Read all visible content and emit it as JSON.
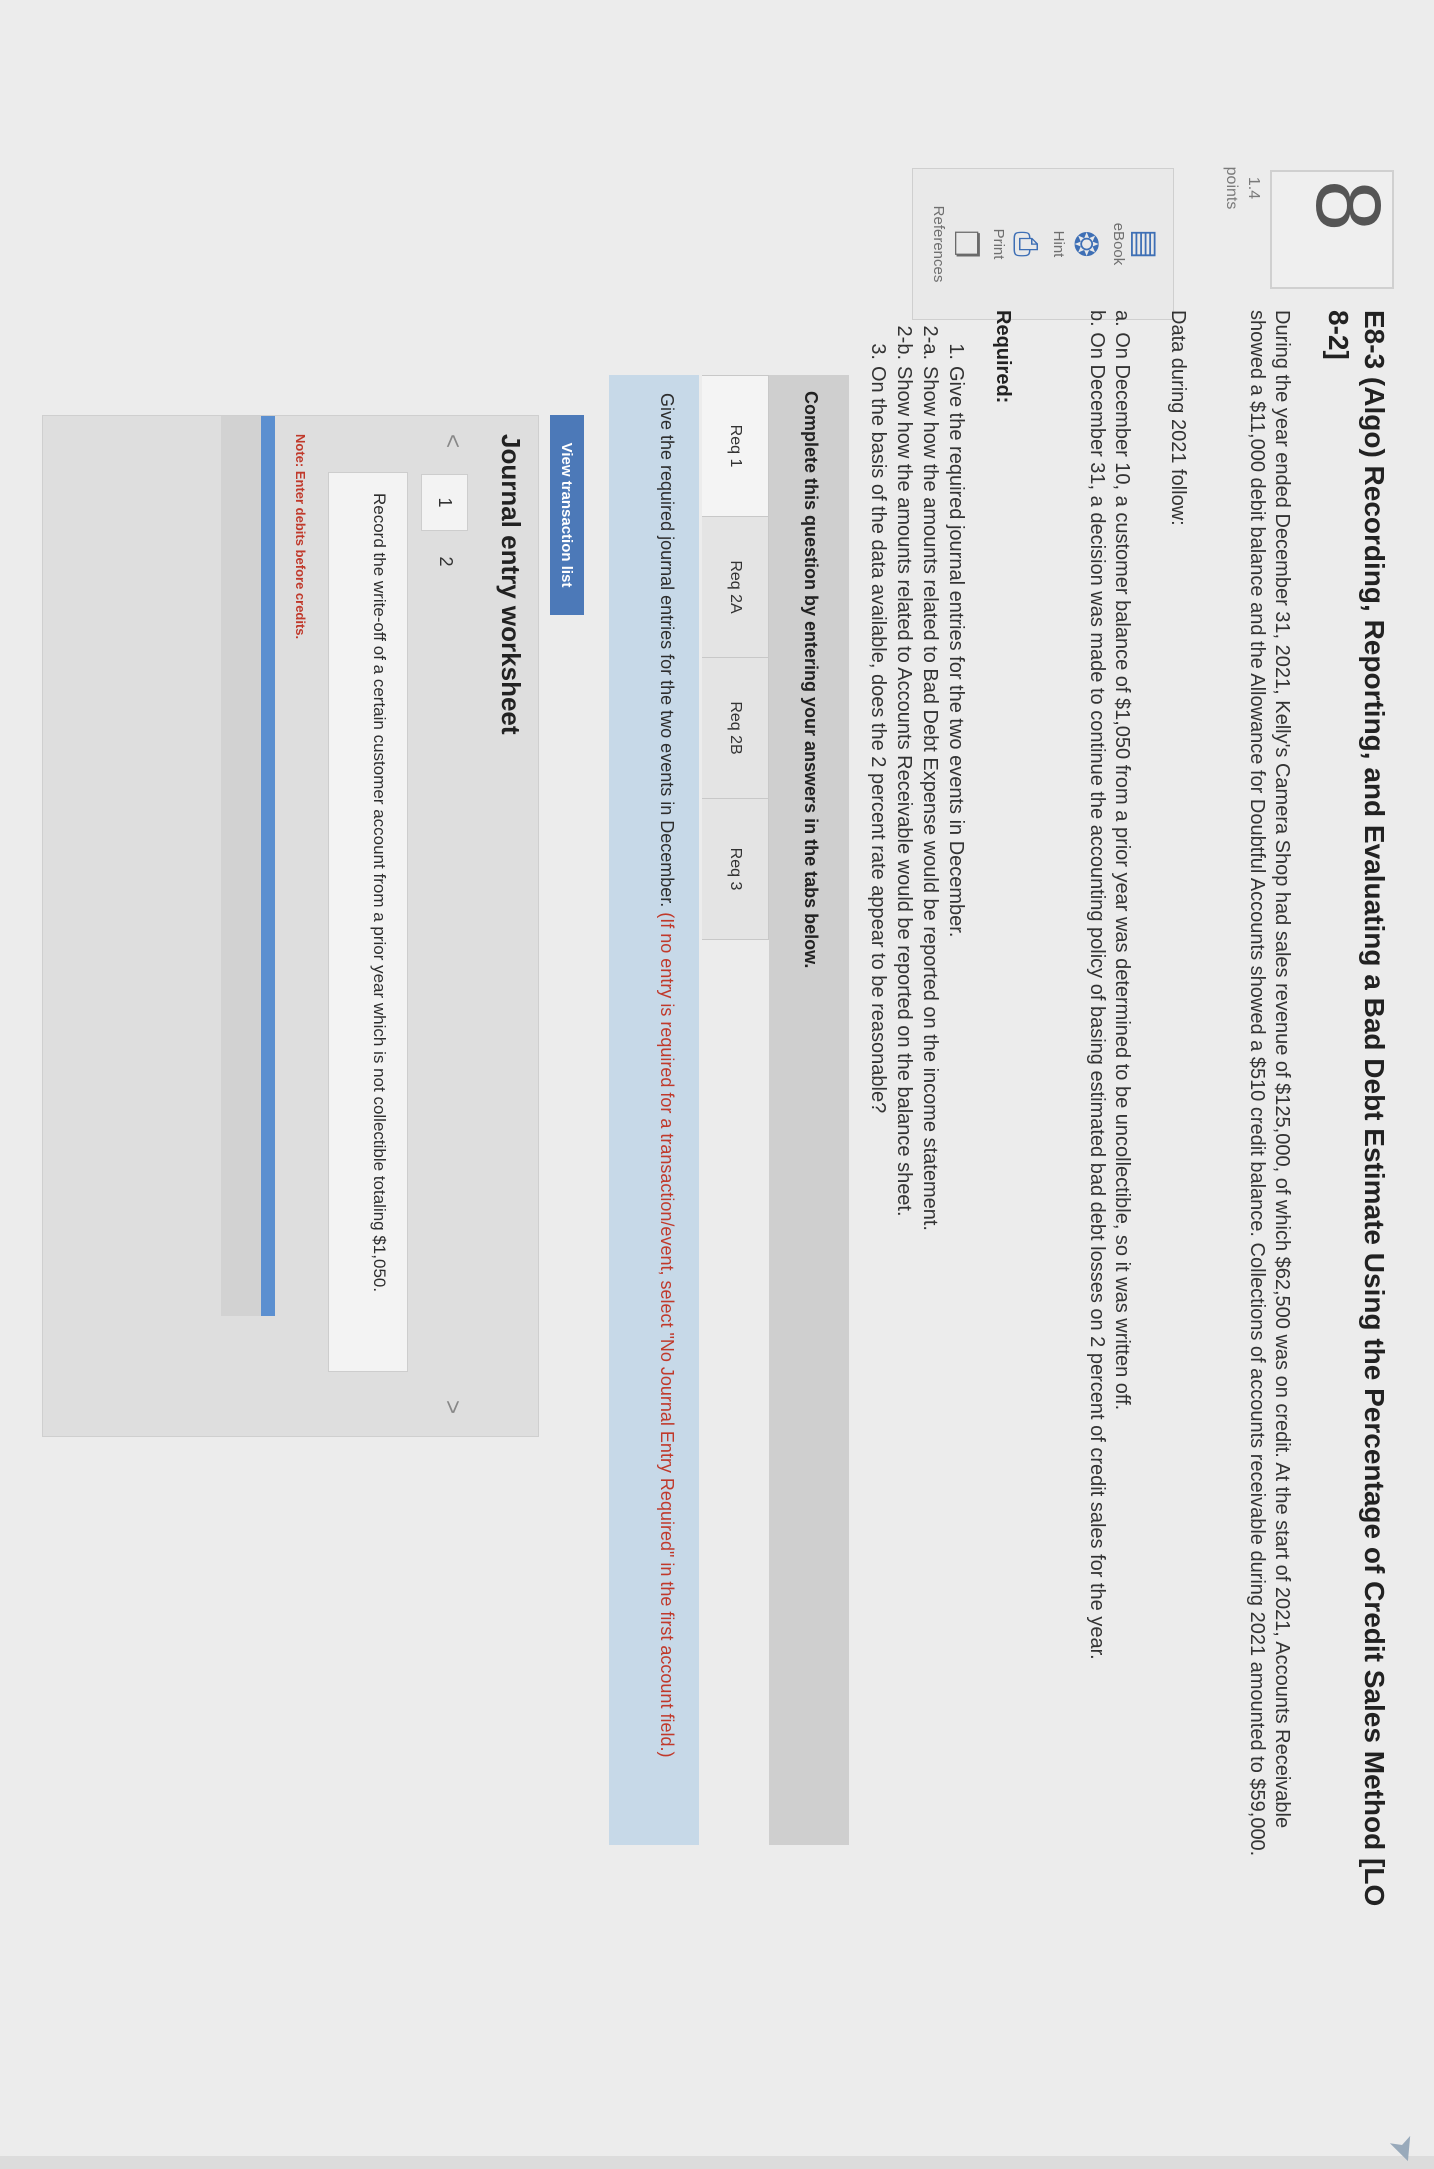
{
  "question": {
    "number": "8",
    "points_value": "1.4",
    "points_label": "points",
    "title": "E8-3 (Algo) Recording, Reporting, and Evaluating a Bad Debt Estimate Using the Percentage of Credit Sales Method [LO 8-2]",
    "intro": "During the year ended December 31, 2021, Kelly's Camera Shop had sales revenue of $125,000, of which $62,500 was on credit. At the start of 2021, Accounts Receivable showed a $11,000 debit balance and the Allowance for Doubtful Accounts showed a $510 credit balance. Collections of accounts receivable during 2021 amounted to $59,000.",
    "data_label": "Data during 2021 follow:",
    "events": [
      "a. On December 10, a customer balance of $1,050 from a prior year was determined to be uncollectible, so it was written off.",
      "b. On December 31, a decision was made to continue the accounting policy of basing estimated bad debt losses on 2 percent of credit sales for the year."
    ],
    "required_heading": "Required:",
    "required": [
      {
        "num": "1.",
        "text": "Give the required journal entries for the two events in December."
      },
      {
        "num": "2-a.",
        "text": "Show how the amounts related to Bad Debt Expense would be reported on the income statement."
      },
      {
        "num": "2-b.",
        "text": "Show how the amounts related to Accounts Receivable would be reported on the balance sheet."
      },
      {
        "num": "3.",
        "text": "On the basis of the data available, does the 2 percent rate appear to be reasonable?"
      }
    ]
  },
  "tools": [
    {
      "label": "eBook",
      "icon": "book-icon"
    },
    {
      "label": "Hint",
      "icon": "lifebuoy-icon"
    },
    {
      "label": "Print",
      "icon": "printer-icon"
    },
    {
      "label": "References",
      "icon": "copy-pages-icon"
    }
  ],
  "complete_instruction": "Complete this question by entering your answers in the tabs below.",
  "tabs": [
    {
      "label": "Req 1",
      "active": true
    },
    {
      "label": "Req 2A",
      "active": false
    },
    {
      "label": "Req 2B",
      "active": false
    },
    {
      "label": "Req 3",
      "active": false
    }
  ],
  "info": {
    "text": "Give the required journal entries for the two events in December.",
    "note": "(If no entry is required for a transaction/event, select \"No Journal Entry Required\" in the first account field.)"
  },
  "view_button": "View transaction list",
  "worksheet": {
    "title": "Journal entry worksheet",
    "pages": [
      "1",
      "2"
    ],
    "prev": "<",
    "next": ">",
    "description": "Record the write-off of a certain customer account from a prior year which is not collectible totaling $1,050.",
    "note": "Note: Enter debits before credits."
  },
  "colors": {
    "accent": "#4c79b8",
    "info_bar": "#c7d9e8",
    "note_red": "#c0392b"
  }
}
